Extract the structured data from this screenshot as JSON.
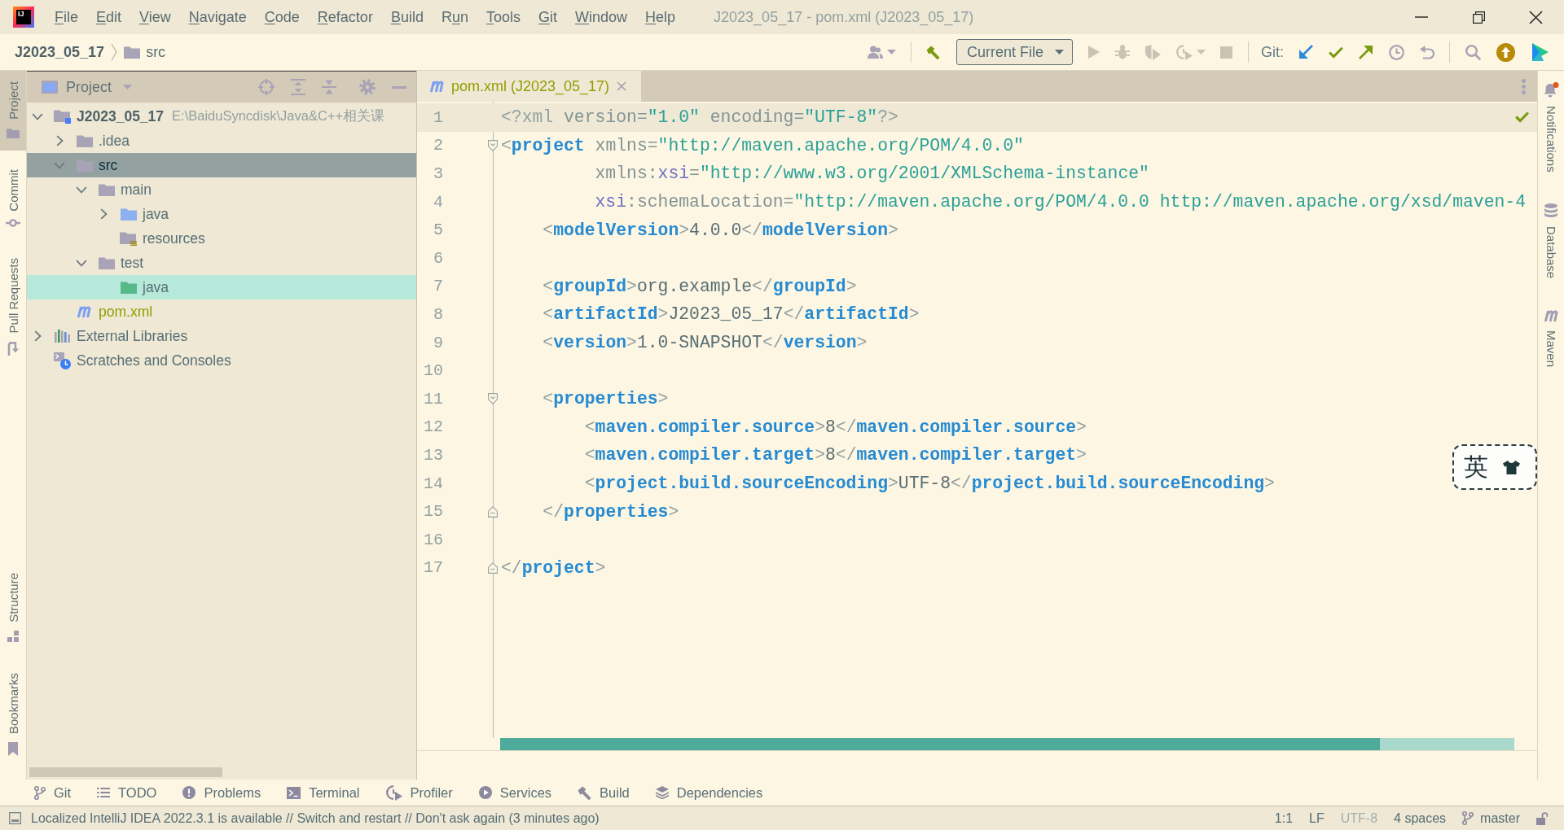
{
  "menu_bar": {
    "logo": "IJ",
    "items": [
      {
        "parts": [
          {
            "text": "F",
            "underlined": true
          },
          {
            "text": "ile"
          }
        ]
      },
      {
        "parts": [
          {
            "text": "E",
            "underlined": true
          },
          {
            "text": "dit"
          }
        ]
      },
      {
        "parts": [
          {
            "text": "V",
            "underlined": true
          },
          {
            "text": "iew"
          }
        ]
      },
      {
        "parts": [
          {
            "text": "N",
            "underlined": true
          },
          {
            "text": "avigate"
          }
        ]
      },
      {
        "parts": [
          {
            "text": "C",
            "underlined": true
          },
          {
            "text": "ode"
          }
        ]
      },
      {
        "parts": [
          {
            "text": "R",
            "underlined": true
          },
          {
            "text": "efactor"
          }
        ]
      },
      {
        "parts": [
          {
            "text": "B",
            "underlined": true
          },
          {
            "text": "uild"
          }
        ]
      },
      {
        "parts": [
          {
            "text": "R"
          },
          {
            "text": "u",
            "underlined": true
          },
          {
            "text": "n"
          }
        ]
      },
      {
        "parts": [
          {
            "text": "T",
            "underlined": true
          },
          {
            "text": "ools"
          }
        ]
      },
      {
        "parts": [
          {
            "text": "G",
            "underlined": true
          },
          {
            "text": "it"
          }
        ]
      },
      {
        "parts": [
          {
            "text": "W",
            "underlined": true
          },
          {
            "text": "indow"
          }
        ]
      },
      {
        "parts": [
          {
            "text": "H",
            "underlined": true
          },
          {
            "text": "elp"
          }
        ]
      }
    ],
    "title": "J2023_05_17 - pom.xml (J2023_05_17)"
  },
  "navigation_bar": {
    "breadcrumbs": [
      {
        "label": "J2023_05_17",
        "kind": "project"
      },
      {
        "label": "src",
        "kind": "folder"
      }
    ],
    "toolbar": {
      "account": [
        {
          "kind": "users",
          "dropdown": true
        }
      ],
      "build": [
        {
          "kind": "build",
          "disabled": false
        }
      ],
      "run_configuration": "Current File",
      "run": [
        {
          "kind": "run",
          "disabled": true
        },
        {
          "kind": "debug",
          "disabled": true
        },
        {
          "kind": "coverage",
          "disabled": true
        },
        {
          "kind": "profile",
          "disabled": true,
          "dropdown": true
        },
        {
          "kind": "stop",
          "disabled": true
        }
      ],
      "git_label": "Git:",
      "git": [
        {
          "kind": "update"
        },
        {
          "kind": "commit"
        },
        {
          "kind": "push"
        },
        {
          "kind": "history"
        },
        {
          "kind": "rollback"
        }
      ],
      "tools": [
        {
          "kind": "search"
        },
        {
          "kind": "upgrade"
        },
        {
          "kind": "toolbox"
        }
      ]
    }
  },
  "left_stripe": {
    "top": [
      {
        "label": "Project",
        "kind": "project",
        "selected": true
      },
      {
        "label": "Commit",
        "kind": "commit",
        "selected": false
      },
      {
        "label": "Pull Requests",
        "kind": "pulls",
        "selected": false
      }
    ],
    "bottom": [
      {
        "label": "Structure",
        "kind": "structure",
        "selected": false
      },
      {
        "label": "Bookmarks",
        "kind": "bookmarks",
        "selected": false
      }
    ]
  },
  "project_panel": {
    "title": "Project",
    "tree": [
      {
        "label": "J2023_05_17",
        "path": "E:\\BaiduSyncdisk\\Java&C++相关课",
        "kind": "module",
        "expanded": true,
        "selected": false,
        "highlighted": false,
        "vcs_added": false,
        "children": [
          {
            "label": ".idea",
            "kind": "folder",
            "expanded": false,
            "selected": false,
            "highlighted": false,
            "vcs_added": false
          },
          {
            "label": "src",
            "kind": "folder",
            "expanded": true,
            "selected": true,
            "highlighted": false,
            "vcs_added": false,
            "children": [
              {
                "label": "main",
                "kind": "folder",
                "expanded": true,
                "selected": false,
                "highlighted": false,
                "vcs_added": false,
                "children": [
                  {
                    "label": "java",
                    "kind": "source",
                    "expanded": false,
                    "selected": false,
                    "highlighted": false,
                    "vcs_added": false
                  },
                  {
                    "label": "resources",
                    "kind": "resources",
                    "selected": false,
                    "highlighted": false,
                    "vcs_added": false
                  }
                ]
              },
              {
                "label": "test",
                "kind": "folder",
                "expanded": true,
                "selected": false,
                "highlighted": false,
                "vcs_added": false,
                "children": [
                  {
                    "label": "java",
                    "kind": "test",
                    "selected": false,
                    "highlighted": true,
                    "vcs_added": false
                  }
                ]
              }
            ]
          },
          {
            "label": "pom.xml",
            "kind": "maven",
            "selected": false,
            "highlighted": false,
            "vcs_added": true
          }
        ]
      },
      {
        "label": "External Libraries",
        "kind": "libraries",
        "expanded": false,
        "selected": false,
        "highlighted": false,
        "vcs_added": false
      },
      {
        "label": "Scratches and Consoles",
        "kind": "scratches",
        "selected": false,
        "highlighted": false,
        "vcs_added": false
      }
    ]
  },
  "editor": {
    "tabs": [
      {
        "label": "pom.xml (J2023_05_17)",
        "selected": true,
        "vcs_added": true
      }
    ],
    "lines": [
      {
        "number": "1",
        "current": true,
        "tokens": [
          {
            "kind": "punct",
            "text": "<?xml"
          },
          {
            "kind": "attr",
            "text": " version="
          },
          {
            "kind": "string",
            "text": "\"1.0\""
          },
          {
            "kind": "attr",
            "text": " encoding="
          },
          {
            "kind": "string",
            "text": "\"UTF-8\""
          },
          {
            "kind": "punct",
            "text": "?>"
          }
        ]
      },
      {
        "number": "2",
        "current": false,
        "fold_start": true,
        "tokens": [
          {
            "kind": "punct",
            "text": "<"
          },
          {
            "kind": "tag",
            "text": "project"
          },
          {
            "kind": "attr",
            "text": " xmlns="
          },
          {
            "kind": "string",
            "text": "\"http://maven.apache.org/POM/4.0.0\""
          }
        ]
      },
      {
        "number": "3",
        "current": false,
        "tokens": [
          {
            "kind": "attr",
            "text": "         xmlns:"
          },
          {
            "kind": "ns",
            "text": "xsi"
          },
          {
            "kind": "attr",
            "text": "="
          },
          {
            "kind": "string",
            "text": "\"http://www.w3.org/2001/XMLSchema-instance\""
          }
        ]
      },
      {
        "number": "4",
        "current": false,
        "tokens": [
          {
            "kind": "ns",
            "text": "         xsi"
          },
          {
            "kind": "attr",
            "text": ":schemaLocation="
          },
          {
            "kind": "string",
            "text": "\"http://maven.apache.org/POM/4.0.0 http://maven.apache.org/xsd/maven-4"
          }
        ]
      },
      {
        "number": "5",
        "current": false,
        "tokens": [
          {
            "kind": "punct",
            "text": "    <"
          },
          {
            "kind": "tag",
            "text": "modelVersion"
          },
          {
            "kind": "punct",
            "text": ">"
          },
          {
            "kind": "text",
            "text": "4.0.0"
          },
          {
            "kind": "punct",
            "text": "</"
          },
          {
            "kind": "tag",
            "text": "modelVersion"
          },
          {
            "kind": "punct",
            "text": ">"
          }
        ]
      },
      {
        "number": "6",
        "current": false
      },
      {
        "number": "7",
        "current": false,
        "tokens": [
          {
            "kind": "punct",
            "text": "    <"
          },
          {
            "kind": "tag",
            "text": "groupId"
          },
          {
            "kind": "punct",
            "text": ">"
          },
          {
            "kind": "text",
            "text": "org.example"
          },
          {
            "kind": "punct",
            "text": "</"
          },
          {
            "kind": "tag",
            "text": "groupId"
          },
          {
            "kind": "punct",
            "text": ">"
          }
        ]
      },
      {
        "number": "8",
        "current": false,
        "tokens": [
          {
            "kind": "punct",
            "text": "    <"
          },
          {
            "kind": "tag",
            "text": "artifactId"
          },
          {
            "kind": "punct",
            "text": ">"
          },
          {
            "kind": "text",
            "text": "J2023_05_17"
          },
          {
            "kind": "punct",
            "text": "</"
          },
          {
            "kind": "tag",
            "text": "artifactId"
          },
          {
            "kind": "punct",
            "text": ">"
          }
        ]
      },
      {
        "number": "9",
        "current": false,
        "tokens": [
          {
            "kind": "punct",
            "text": "    <"
          },
          {
            "kind": "tag",
            "text": "version"
          },
          {
            "kind": "punct",
            "text": ">"
          },
          {
            "kind": "text",
            "text": "1.0-SNAPSHOT"
          },
          {
            "kind": "punct",
            "text": "</"
          },
          {
            "kind": "tag",
            "text": "version"
          },
          {
            "kind": "punct",
            "text": ">"
          }
        ]
      },
      {
        "number": "10",
        "current": false
      },
      {
        "number": "11",
        "current": false,
        "fold_start": true,
        "tokens": [
          {
            "kind": "punct",
            "text": "    <"
          },
          {
            "kind": "tag",
            "text": "properties"
          },
          {
            "kind": "punct",
            "text": ">"
          }
        ]
      },
      {
        "number": "12",
        "current": false,
        "tokens": [
          {
            "kind": "punct",
            "text": "        <"
          },
          {
            "kind": "tag",
            "text": "maven.compiler.source"
          },
          {
            "kind": "punct",
            "text": ">"
          },
          {
            "kind": "text",
            "text": "8"
          },
          {
            "kind": "punct",
            "text": "</"
          },
          {
            "kind": "tag",
            "text": "maven.compiler.source"
          },
          {
            "kind": "punct",
            "text": ">"
          }
        ]
      },
      {
        "number": "13",
        "current": false,
        "tokens": [
          {
            "kind": "punct",
            "text": "        <"
          },
          {
            "kind": "tag",
            "text": "maven.compiler.target"
          },
          {
            "kind": "punct",
            "text": ">"
          },
          {
            "kind": "text",
            "text": "8"
          },
          {
            "kind": "punct",
            "text": "</"
          },
          {
            "kind": "tag",
            "text": "maven.compiler.target"
          },
          {
            "kind": "punct",
            "text": ">"
          }
        ]
      },
      {
        "number": "14",
        "current": false,
        "tokens": [
          {
            "kind": "punct",
            "text": "        <"
          },
          {
            "kind": "tag",
            "text": "project.build.sourceEncoding"
          },
          {
            "kind": "punct",
            "text": ">"
          },
          {
            "kind": "text",
            "text": "UTF-8"
          },
          {
            "kind": "punct",
            "text": "</"
          },
          {
            "kind": "tag",
            "text": "project.build.sourceEncoding"
          },
          {
            "kind": "punct",
            "text": ">"
          }
        ]
      },
      {
        "number": "15",
        "current": false,
        "fold_end": true,
        "tokens": [
          {
            "kind": "punct",
            "text": "    </"
          },
          {
            "kind": "tag",
            "text": "properties"
          },
          {
            "kind": "punct",
            "text": ">"
          }
        ]
      },
      {
        "number": "16",
        "current": false
      },
      {
        "number": "17",
        "current": false,
        "fold_end": true,
        "tokens": [
          {
            "kind": "punct",
            "text": "</"
          },
          {
            "kind": "tag",
            "text": "project"
          },
          {
            "kind": "punct",
            "text": ">"
          }
        ]
      }
    ]
  },
  "right_stripe": [
    {
      "label": "Notifications",
      "kind": "notifications",
      "unread": true,
      "selected": false
    },
    {
      "label": "Database",
      "kind": "database",
      "selected": false
    },
    {
      "label": "Maven",
      "kind": "maven",
      "selected": false
    }
  ],
  "tool_windows": [
    {
      "label": "Git",
      "kind": "git",
      "selected": false
    },
    {
      "label": "TODO",
      "kind": "todo",
      "selected": false
    },
    {
      "label": "Problems",
      "kind": "problems",
      "selected": false
    },
    {
      "label": "Terminal",
      "kind": "terminal",
      "selected": false
    },
    {
      "label": "Profiler",
      "kind": "profiler",
      "selected": false
    },
    {
      "label": "Services",
      "kind": "services",
      "selected": false
    },
    {
      "label": "Build",
      "kind": "build",
      "selected": false
    },
    {
      "label": "Dependencies",
      "kind": "dependencies",
      "selected": false
    }
  ],
  "status_bar": {
    "message": "Localized IntelliJ IDEA 2022.3.1 is available // Switch and restart // Don't ask again (3 minutes ago)",
    "widgets": [
      {
        "label": "1:1",
        "kind": "text",
        "disabled": false
      },
      {
        "label": "LF",
        "kind": "text",
        "disabled": false
      },
      {
        "label": "UTF-8",
        "kind": "text",
        "disabled": true
      },
      {
        "label": "4 spaces",
        "kind": "text",
        "disabled": false
      },
      {
        "label": "master",
        "kind": "branch",
        "disabled": false
      }
    ]
  },
  "ime_indicator": {
    "label": "英"
  }
}
